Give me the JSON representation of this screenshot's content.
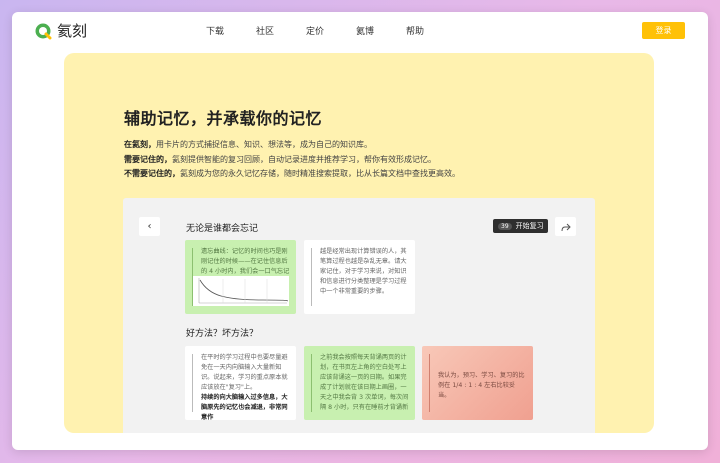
{
  "nav": {
    "logo_text": "氦刻",
    "links": [
      "下载",
      "社区",
      "定价",
      "氦博",
      "帮助"
    ],
    "login_label": "登录",
    "accent_color": "#ffc107"
  },
  "hero": {
    "title": "辅助记忆，并承载你的记忆",
    "lines": [
      {
        "bold": "在氦刻，",
        "text": "用卡片的方式捕捉信息、知识、想法等，成为自己的知识库。"
      },
      {
        "bold": "需要记住的，",
        "text": "氦刻提供智能的复习回顾，自动记录进度并推荐学习，帮你有效形成记忆。"
      },
      {
        "bold": "不需要记住的，",
        "text": "氦刻成为您的永久记忆存储，随时精准搜索提取，比从长篇文档中查找更高效。"
      }
    ],
    "background_color": "#fff2b0"
  },
  "mock": {
    "section1_title": "无论是谁都会忘记",
    "review_count": "39",
    "review_label": "开始复习",
    "section2_title": "好方法？坏方法？",
    "cards_row1": [
      {
        "text": "遗忘曲线：记忆的时间也巧是刚刚记住的时候——在记住信息后的 4 小时内，我们会一口气忘记大约",
        "color": "green"
      },
      {
        "text": "越是经常出现计算错误的人，其笔算过程也越是杂乱无章。请大家记住，对于学习来说，对知识和信息进行分类整理是学习过程中一个非常重要的步骤。",
        "color": "white"
      }
    ],
    "cards_row2": [
      {
        "text": "在平时的学习过程中也要尽量避免在一天内向脑输入大量新知识。说起来，学习的重点原本就应该放在\"复习\"上。",
        "strong": "持续的向大脑输入过多信息，大脑原先的记忆也会减退，非常同意作",
        "color": "white"
      },
      {
        "text": "之前我会按照每天背诵两页的计划，在书页左上角的空白处写上应该背诵这一页的日期。如果完成了计划就在该日期上画圈，一天之中我会背 3 次单词，每次间隔 8 小时，只有在睡前才背诵新",
        "color": "green"
      },
      {
        "text": "我认为，预习、学习、复习的比例在 1/4 : 1 : 4 左右比较妥当。",
        "color": "pink"
      }
    ]
  }
}
